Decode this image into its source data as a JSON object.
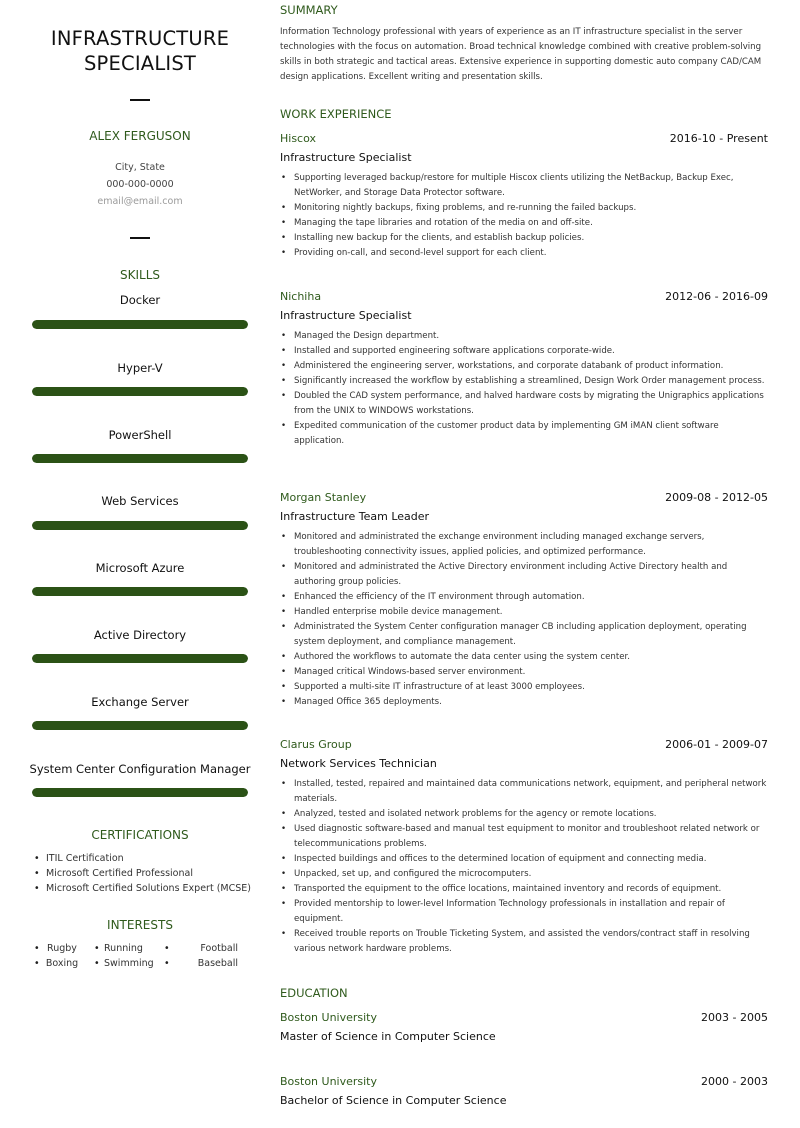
{
  "sidebar": {
    "title_line1": "INFRASTRUCTURE",
    "title_line2": "SPECIALIST",
    "name": "ALEX FERGUSON",
    "location": "City, State",
    "phone": "000-000-0000",
    "email": "email@email.com",
    "skills_heading": "SKILLS",
    "skills": [
      {
        "name": "Docker",
        "level": 1.0
      },
      {
        "name": "Hyper-V",
        "level": 1.0
      },
      {
        "name": "PowerShell",
        "level": 1.0
      },
      {
        "name": "Web Services",
        "level": 1.0
      },
      {
        "name": "Microsoft Azure",
        "level": 1.0
      },
      {
        "name": "Active Directory",
        "level": 1.0
      },
      {
        "name": "Exchange Server",
        "level": 1.0
      },
      {
        "name": "System Center Configuration Manager",
        "level": 1.0
      }
    ],
    "certifications_heading": "CERTIFICATIONS",
    "certifications": [
      "ITIL Certification",
      "Microsoft Certified Professional",
      "Microsoft Certified Solutions Expert (MCSE)"
    ],
    "interests_heading": "INTERESTS",
    "interests": [
      "Rugby",
      "Running",
      "Football",
      "Boxing",
      "Swimming",
      "Baseball"
    ]
  },
  "main": {
    "summary_heading": "SUMMARY",
    "summary": "Information Technology professional with years of experience as an IT infrastructure specialist in the server technologies with the focus on automation. Broad technical knowledge combined with creative problem-solving skills in both strategic and tactical areas. Extensive experience in supporting domestic auto company CAD/CAM design applications. Excellent writing and presentation skills.",
    "experience_heading": "WORK EXPERIENCE",
    "jobs": [
      {
        "company": "Hiscox",
        "dates": "2016-10 - Present",
        "title": "Infrastructure Specialist",
        "bullets": [
          "Supporting leveraged backup/restore for multiple Hiscox clients utilizing the NetBackup, Backup Exec, NetWorker, and Storage Data Protector software.",
          "Monitoring nightly backups, fixing problems, and re-running the failed backups.",
          "Managing the tape libraries and rotation of the media on and off-site.",
          "Installing new backup for the clients, and establish backup policies.",
          "Providing on-call, and second-level support for each client."
        ]
      },
      {
        "company": "Nichiha",
        "dates": "2012-06 - 2016-09",
        "title": "Infrastructure Specialist",
        "bullets": [
          "Managed the Design department.",
          "Installed and supported engineering software applications corporate-wide.",
          "Administered the engineering server, workstations, and corporate databank of product information.",
          "Significantly increased the workflow by establishing a streamlined, Design Work Order management process.",
          "Doubled the CAD system performance, and halved hardware costs by migrating the Unigraphics applications from the UNIX to WINDOWS workstations.",
          "Expedited communication of the customer product data by implementing GM iMAN client software application."
        ]
      },
      {
        "company": "Morgan Stanley",
        "dates": "2009-08 - 2012-05",
        "title": "Infrastructure Team Leader",
        "bullets": [
          "Monitored and administrated the exchange environment including managed exchange servers, troubleshooting connectivity issues, applied policies, and optimized performance.",
          "Monitored and administrated the Active Directory environment including Active Directory health and authoring group policies.",
          "Enhanced the efficiency of the IT environment through automation.",
          "Handled enterprise mobile device management.",
          "Administrated the System Center configuration manager CB including application deployment, operating system deployment, and compliance management.",
          "Authored the workflows to automate the data center using the system center.",
          "Managed critical Windows-based server environment.",
          "Supported a multi-site IT infrastructure of at least 3000 employees.",
          "Managed Office 365 deployments."
        ]
      },
      {
        "company": "Clarus Group",
        "dates": "2006-01 - 2009-07",
        "title": "Network Services Technician",
        "bullets": [
          "Installed, tested, repaired and maintained data communications network, equipment, and peripheral network materials.",
          "Analyzed, tested and isolated network problems for the agency or remote locations.",
          "Used diagnostic software-based and manual test equipment to monitor and troubleshoot related network or telecommunications problems.",
          "Inspected buildings and offices to the determined location of equipment and connecting media.",
          "Unpacked, set up, and configured the microcomputers.",
          "Transported the equipment to the office locations, maintained inventory and records of equipment.",
          "Provided mentorship to lower-level Information Technology professionals in installation and repair of equipment.",
          "Received trouble reports on Trouble Ticketing System, and assisted the vendors/contract staff in resolving various network hardware problems."
        ]
      }
    ],
    "education_heading": "EDUCATION",
    "education": [
      {
        "school": "Boston University",
        "dates": "2003 - 2005",
        "degree": "Master of Science in Computer Science"
      },
      {
        "school": "Boston University",
        "dates": "2000 - 2003",
        "degree": "Bachelor of Science in Computer Science"
      }
    ]
  },
  "colors": {
    "accent": "#2f5a1c",
    "skill_bar": "#2b5216"
  }
}
